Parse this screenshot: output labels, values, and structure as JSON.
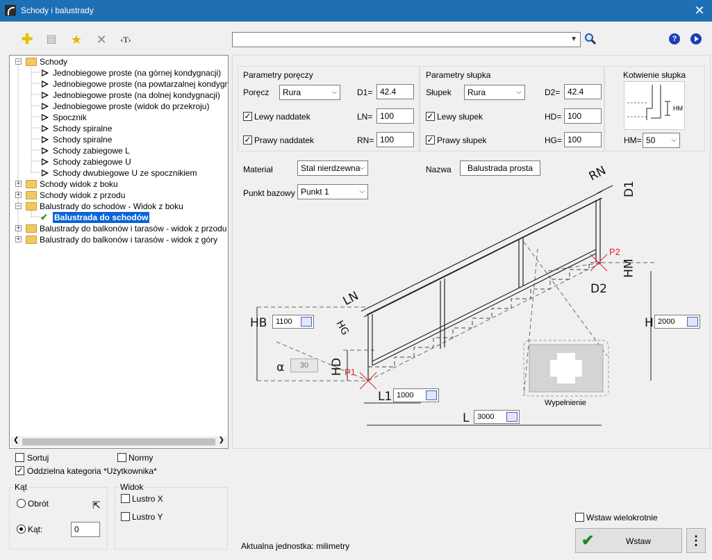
{
  "window": {
    "title": "Schody i balustrady"
  },
  "toolbar": {
    "add_icon": "add-icon",
    "list_icon": "list-icon",
    "star_icon": "star-icon",
    "delete_icon": "delete-icon",
    "text_label": "‹T›"
  },
  "search": {
    "value": ""
  },
  "tree": {
    "items": [
      {
        "label": "Schody",
        "type": "folder",
        "expanded": true
      },
      {
        "label": "Jednobiegowe proste (na górnej kondygnacji)",
        "type": "leaf"
      },
      {
        "label": "Jednobiegowe proste (na powtarzalnej kondygnacji)",
        "type": "leaf"
      },
      {
        "label": "Jednobiegowe proste (na dolnej kondygnacji)",
        "type": "leaf"
      },
      {
        "label": "Jednobiegowe proste (widok do przekroju)",
        "type": "leaf"
      },
      {
        "label": "Spocznik",
        "type": "leaf"
      },
      {
        "label": "Schody spiralne",
        "type": "leaf"
      },
      {
        "label": "Schody spiralne",
        "type": "leaf"
      },
      {
        "label": "Schody zabiegowe L",
        "type": "leaf"
      },
      {
        "label": "Schody zabiegowe U",
        "type": "leaf"
      },
      {
        "label": "Schody dwubiegowe U ze spocznikiem",
        "type": "leaf"
      },
      {
        "label": "Schody widok z boku",
        "type": "folder",
        "expanded": false
      },
      {
        "label": "Schody widok z przodu",
        "type": "folder",
        "expanded": false
      },
      {
        "label": "Balustrady do schodów - Widok z boku",
        "type": "folder",
        "expanded": true
      },
      {
        "label": "Balustrada do schodów",
        "type": "selected"
      },
      {
        "label": "Balustrady do balkonów i tarasów - widok z przodu",
        "type": "folder",
        "expanded": false
      },
      {
        "label": "Balustrady do balkonów i tarasów - widok z góry",
        "type": "folder",
        "expanded": false
      }
    ]
  },
  "options": {
    "sortuj": "Sortuj",
    "sortuj_checked": false,
    "normy": "Normy",
    "normy_checked": false,
    "oddzielna": "Oddzielna kategoria *Użytkownika*",
    "oddzielna_checked": true
  },
  "kat": {
    "title": "Kąt",
    "obrot": "Obrót",
    "kat_label": "Kąt:",
    "kat_value": "0",
    "selected": "kat"
  },
  "widok": {
    "title": "Widok",
    "lustro_x": "Lustro X",
    "lustro_y": "Lustro Y"
  },
  "porecz": {
    "title": "Parametry poręczy",
    "porecz_label": "Poręcz",
    "porecz_value": "Rura",
    "d1_label": "D1=",
    "d1_value": "42.4",
    "lewy_label": "Lewy naddatek",
    "ln_label": "LN=",
    "ln_value": "100",
    "prawy_label": "Prawy naddatek",
    "rn_label": "RN=",
    "rn_value": "100"
  },
  "slupek": {
    "title": "Parametry słupka",
    "slupek_label": "Słupek",
    "slupek_value": "Rura",
    "d2_label": "D2=",
    "d2_value": "42.4",
    "lewy_label": "Lewy słupek",
    "hd_label": "HD=",
    "hd_value": "100",
    "prawy_label": "Prawy słupek",
    "hg_label": "HG=",
    "hg_value": "100"
  },
  "kotwienie": {
    "title": "Kotwienie słupka",
    "hm_label": "HM=",
    "hm_value": "50",
    "hm_diag": "HM"
  },
  "material": {
    "label": "Materiał",
    "value": "Stal nierdzewna"
  },
  "nazwa": {
    "label": "Nazwa",
    "value": "Balustrada prosta"
  },
  "punkt": {
    "label": "Punkt bazowy",
    "value": "Punkt 1"
  },
  "diagram": {
    "hb": "HB",
    "hb_value": "1100",
    "alpha": "α",
    "alpha_value": "30",
    "hd": "HD",
    "p1": "P1",
    "p2": "P2",
    "l1": "L1",
    "l1_value": "1000",
    "l": "L",
    "l_value": "3000",
    "h": "H",
    "h_value": "2000",
    "hm": "HM",
    "d2": "D2",
    "d1": "D1",
    "rn": "RN",
    "ln": "LN",
    "hg": "HG",
    "wypelnienie": "Wypełnienie"
  },
  "bottom": {
    "wstaw_wielokrotnie": "Wstaw wielokrotnie",
    "wstaw": "Wstaw",
    "jednostka": "Aktualna jednostka: milimetry",
    "more": "⋮"
  },
  "colors": {
    "title_bar": "#1f6fb5",
    "selection": "#0a64d6",
    "p_marker": "#e0202a"
  }
}
